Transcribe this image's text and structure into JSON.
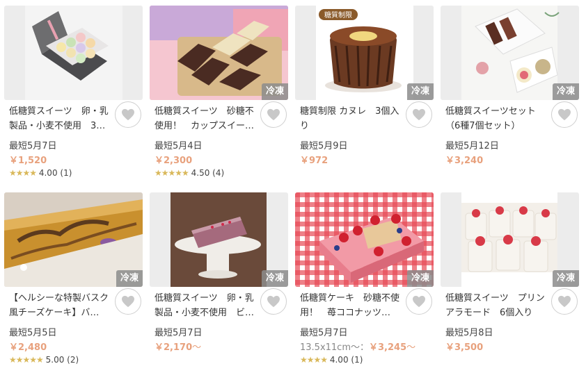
{
  "colors": {
    "price": "#e8a17d",
    "star": "#d9b85a",
    "badge_bg": "#8c8c8c",
    "border": "#cfcfcf"
  },
  "icons": {
    "favorite": "heart-icon",
    "rating": "star-icon"
  },
  "products": [
    {
      "title": "低糖質スイーツ　卵・乳製品・小麦不使用　3…",
      "ship": "最短5月7日",
      "price": "￥1,520",
      "price_suffix": "",
      "size": "",
      "stars": "★★★★",
      "rating": "4.00 (1)",
      "badge": ""
    },
    {
      "title": "低糖質スイーツ　砂糖不使用！　カップスイー…",
      "ship": "最短5月4日",
      "price": "￥2,300",
      "price_suffix": "",
      "size": "",
      "stars": "★★★★★",
      "rating": "4.50 (4)",
      "badge": "冷凍"
    },
    {
      "title": "糖質制限 カヌレ　3個入り",
      "ship": "最短5月9日",
      "price": "￥972",
      "price_suffix": "",
      "size": "",
      "stars": "",
      "rating": "",
      "badge": "冷凍",
      "image_label": "糖質制限"
    },
    {
      "title": "低糖質スイーツセット（6種7個セット）",
      "ship": "最短5月12日",
      "price": "￥3,240",
      "price_suffix": "",
      "size": "",
      "stars": "",
      "rating": "",
      "badge": "冷凍"
    },
    {
      "title": "【ヘルシーな特製バスク風チーズケーキ】バ…",
      "ship": "最短5月5日",
      "price": "￥2,480",
      "price_suffix": "",
      "size": "",
      "stars": "★★★★★",
      "rating": "5.00 (2)",
      "badge": "冷凍"
    },
    {
      "title": "低糖質スイーツ　卵・乳製品・小麦不使用　ビ…",
      "ship": "最短5月7日",
      "price": "￥2,170",
      "price_suffix": "～",
      "size": "",
      "stars": "",
      "rating": "",
      "badge": "冷凍"
    },
    {
      "title": "低糖質ケーキ　砂糖不使用！　苺ココナッツ…",
      "ship": "最短5月7日",
      "price": "￥3,245",
      "price_suffix": "～",
      "size": "13.5x11cm～：",
      "stars": "★★★★",
      "rating": "4.00 (1)",
      "badge": "冷凍"
    },
    {
      "title": "低糖質スイーツ　プリンアラモード　6個入り",
      "ship": "最短5月8日",
      "price": "￥3,500",
      "price_suffix": "",
      "size": "",
      "stars": "",
      "rating": "",
      "badge": "冷凍"
    }
  ]
}
